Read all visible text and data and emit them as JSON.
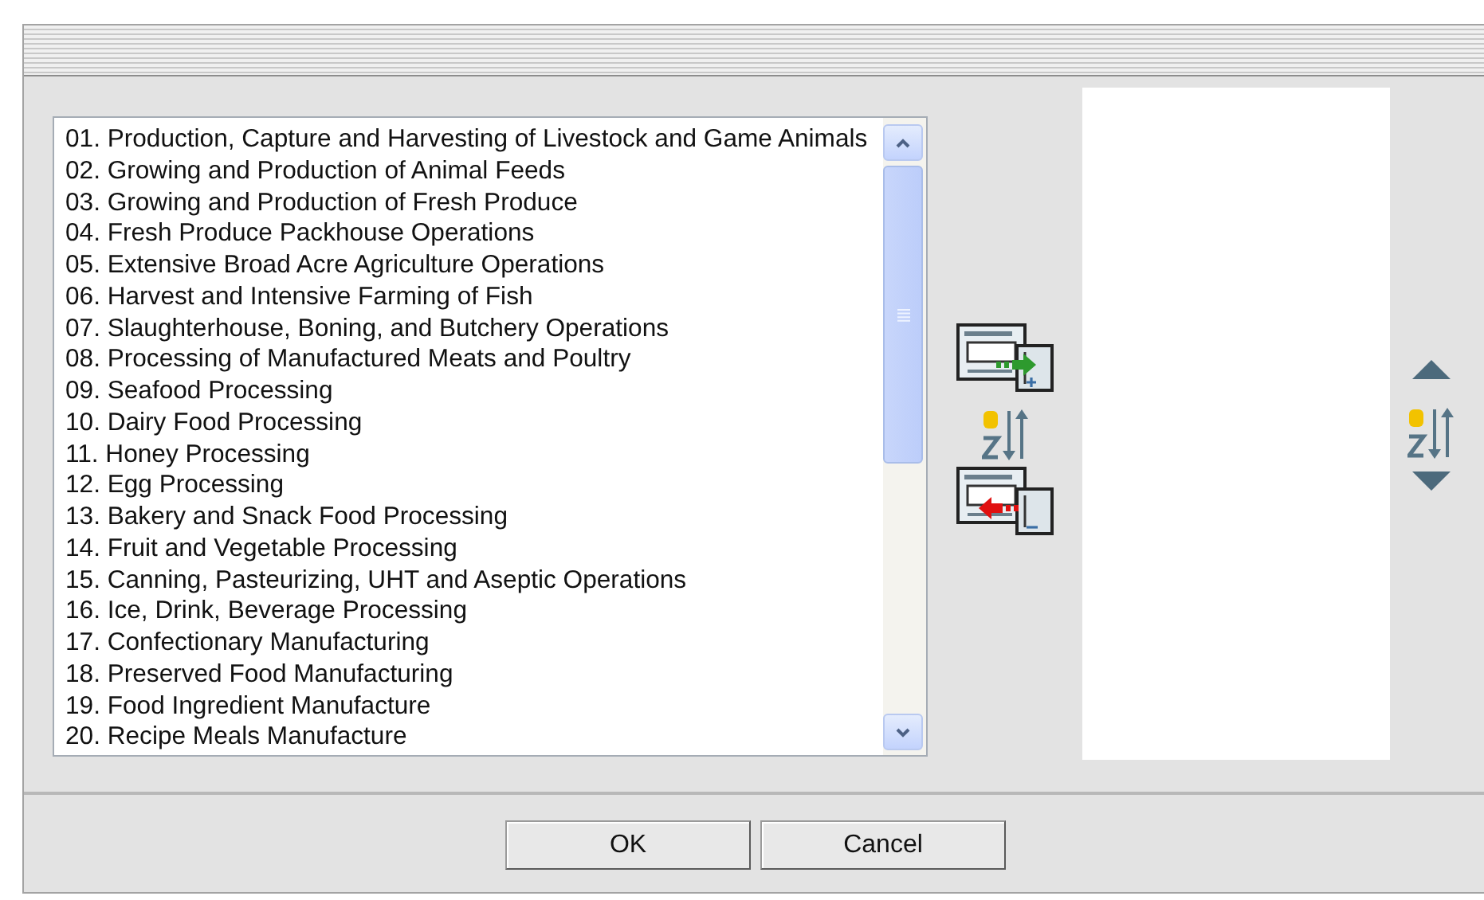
{
  "available_list": {
    "items": [
      "01. Production, Capture and Harvesting of Livestock and Game Animals",
      "02. Growing and Production of Animal Feeds",
      "03. Growing and Production of Fresh Produce",
      "04. Fresh Produce Packhouse Operations",
      "05. Extensive Broad Acre Agriculture Operations",
      "06. Harvest and Intensive Farming of Fish",
      "07. Slaughterhouse, Boning, and Butchery Operations",
      "08. Processing of Manufactured Meats and Poultry",
      "09. Seafood Processing",
      "10. Dairy Food Processing",
      "11. Honey Processing",
      "12. Egg Processing",
      "13. Bakery and Snack Food Processing",
      "14. Fruit and Vegetable Processing",
      "15. Canning, Pasteurizing, UHT and Aseptic Operations",
      "16. Ice, Drink, Beverage Processing",
      "17. Confectionary Manufacturing",
      "18. Preserved Food Manufacturing",
      "19. Food Ingredient Manufacture",
      "20. Recipe Meals Manufacture"
    ]
  },
  "buttons": [
    "OK",
    "Cancel"
  ]
}
